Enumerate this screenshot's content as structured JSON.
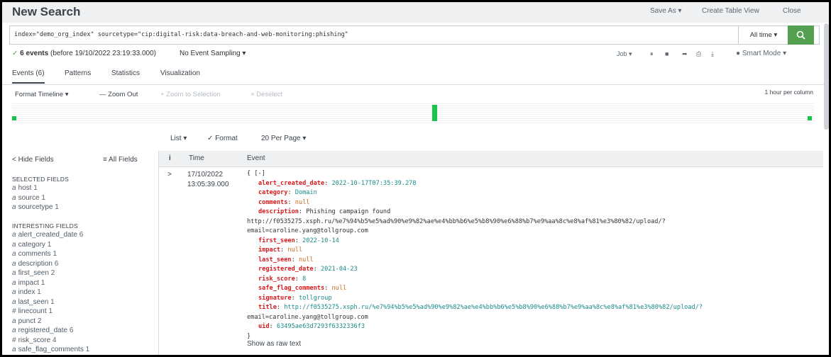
{
  "header": {
    "title": "New Search",
    "save_as": "Save As ▾",
    "create_table_view": "Create Table View",
    "close": "Close"
  },
  "search": {
    "query": "index=\"demo_org_index\" sourcetype=\"cip:digital-risk:data-breach-and-web-monitoring:phishing\"",
    "time_range": "All time ▾",
    "submit_icon": "search-icon"
  },
  "status": {
    "check": "✓",
    "events_count": "6 events",
    "before": "(before 19/10/2022 23:19:33.000)",
    "sampling": "No Event Sampling ▾",
    "job": "Job ▾",
    "smart_mode": "Smart Mode ▾"
  },
  "tabs": [
    "Events (6)",
    "Patterns",
    "Statistics",
    "Visualization"
  ],
  "timeline": {
    "format": "Format Timeline ▾",
    "zoom_out": "— Zoom Out",
    "zoom_selection": "+ Zoom to Selection",
    "deselect": "× Deselect",
    "scale": "1 hour per column"
  },
  "results_toolbar": {
    "list": "List ▾",
    "format": "✓ Format",
    "per_page": "20 Per Page ▾"
  },
  "sidebar": {
    "hide_fields": "< Hide Fields",
    "all_fields": "≡ All Fields",
    "selected_title": "SELECTED FIELDS",
    "selected": [
      {
        "type": "a",
        "name": "host",
        "count": "1"
      },
      {
        "type": "a",
        "name": "source",
        "count": "1"
      },
      {
        "type": "a",
        "name": "sourcetype",
        "count": "1"
      }
    ],
    "interesting_title": "INTERESTING FIELDS",
    "interesting": [
      {
        "type": "a",
        "name": "alert_created_date",
        "count": "6"
      },
      {
        "type": "a",
        "name": "category",
        "count": "1"
      },
      {
        "type": "a",
        "name": "comments",
        "count": "1"
      },
      {
        "type": "a",
        "name": "description",
        "count": "6"
      },
      {
        "type": "a",
        "name": "first_seen",
        "count": "2"
      },
      {
        "type": "a",
        "name": "impact",
        "count": "1"
      },
      {
        "type": "a",
        "name": "index",
        "count": "1"
      },
      {
        "type": "a",
        "name": "last_seen",
        "count": "1"
      },
      {
        "type": "#",
        "name": "linecount",
        "count": "1"
      },
      {
        "type": "a",
        "name": "punct",
        "count": "2"
      },
      {
        "type": "a",
        "name": "registered_date",
        "count": "6"
      },
      {
        "type": "#",
        "name": "risk_score",
        "count": "4"
      },
      {
        "type": "a",
        "name": "safe_flag_comments",
        "count": "1"
      }
    ]
  },
  "table": {
    "col_i": "i",
    "col_time": "Time",
    "col_event": "Event",
    "row": {
      "expand": ">",
      "date": "17/10/2022",
      "time": "13:05:39.000",
      "open": "{ [-]",
      "fields": [
        {
          "key": "alert_created_date",
          "value": "2022-10-17T07:35:39.278",
          "kind": "s"
        },
        {
          "key": "category",
          "value": "Domain",
          "kind": "s"
        },
        {
          "key": "comments",
          "value": "null",
          "kind": "n"
        },
        {
          "key": "description",
          "value": "Phishing campaign found",
          "kind": "p"
        },
        {
          "key": "first_seen",
          "value": "2022-10-14",
          "kind": "s"
        },
        {
          "key": "impact",
          "value": "null",
          "kind": "n"
        },
        {
          "key": "last_seen",
          "value": "null",
          "kind": "n"
        },
        {
          "key": "registered_date",
          "value": "2021-04-23",
          "kind": "s"
        },
        {
          "key": "risk_score",
          "value": "8",
          "kind": "s"
        },
        {
          "key": "safe_flag_comments",
          "value": "null",
          "kind": "n"
        },
        {
          "key": "signature",
          "value": "tollgroup",
          "kind": "s"
        },
        {
          "key": "title",
          "value": "http://f0535275.xsph.ru/%e7%94%b5%e5%ad%90%e9%82%ae%e4%bb%b6%e5%b8%90%e6%88%b7%e9%aa%8c%e8%af%81%e3%80%82/upload/?",
          "kind": "s"
        },
        {
          "key": "uid",
          "value": "63495ae63d7293f6332336f3",
          "kind": "s"
        }
      ],
      "desc_line2": "http://f0535275.xsph.ru/%e7%94%b5%e5%ad%90%e9%82%ae%e4%bb%b6%e5%b8%90%e6%88%b7%e9%aa%8c%e8%af%81%e3%80%82/upload/?",
      "desc_line3": "email=caroline.yang@tollgroup.com",
      "title_line2": "email=caroline.yang@tollgroup.com",
      "close": "}",
      "show_raw": "Show as raw text"
    }
  },
  "colors": {
    "accent_green": "#53a051",
    "timeline_green": "#1ac44a",
    "key_red": "#d7191c",
    "value_teal": "#1a8a8a"
  }
}
